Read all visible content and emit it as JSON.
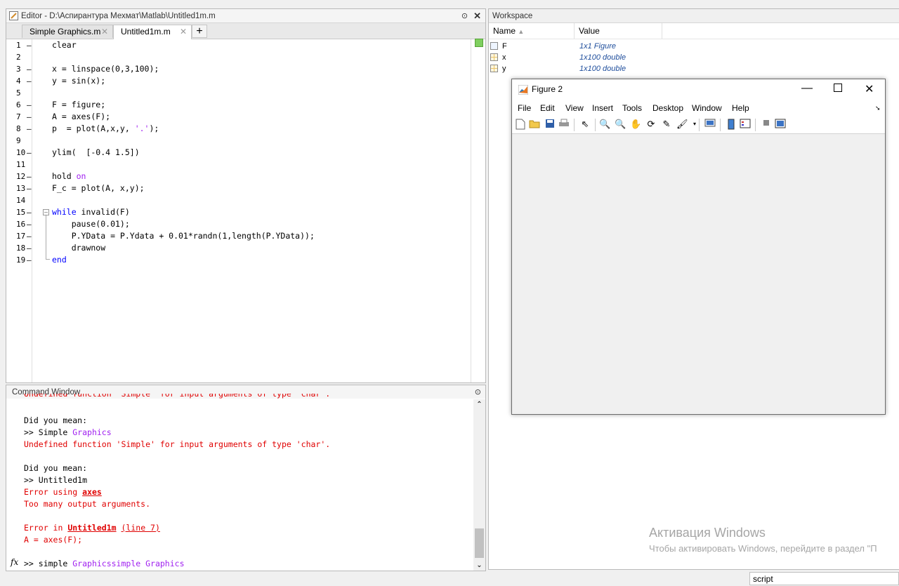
{
  "editor": {
    "title": "Editor - D:\\Аспирантура Мехмат\\Matlab\\Untitled1m.m",
    "tabs": [
      {
        "label": "Simple Graphics.m"
      },
      {
        "label": "Untitled1m.m"
      }
    ],
    "add_tab": "+",
    "lines": [
      {
        "n": "1",
        "dash": "–",
        "code": "clear"
      },
      {
        "n": "2",
        "dash": "",
        "code": ""
      },
      {
        "n": "3",
        "dash": "–",
        "code": "x = linspace(0,3,100);"
      },
      {
        "n": "4",
        "dash": "–",
        "code": "y = sin(x);"
      },
      {
        "n": "5",
        "dash": "",
        "code": ""
      },
      {
        "n": "6",
        "dash": "–",
        "code": "F = figure;"
      },
      {
        "n": "7",
        "dash": "–",
        "code": "A = axes(F);"
      },
      {
        "n": "8",
        "dash": "–",
        "code_pre": "p  = plot(A,x,y, ",
        "code_str": "'.'",
        "code_post": ");"
      },
      {
        "n": "9",
        "dash": "",
        "code": ""
      },
      {
        "n": "10",
        "dash": "–",
        "code": "ylim(  [-0.4 1.5])"
      },
      {
        "n": "11",
        "dash": "",
        "code": ""
      },
      {
        "n": "12",
        "dash": "–",
        "code_pre": "hold ",
        "code_str": "on"
      },
      {
        "n": "13",
        "dash": "–",
        "code": "F_c = plot(A, x,y);"
      },
      {
        "n": "14",
        "dash": "",
        "code": ""
      },
      {
        "n": "15",
        "dash": "–",
        "code_kw": "while",
        "code_post": " invalid(F)"
      },
      {
        "n": "16",
        "dash": "–",
        "code": "    pause(0.01);"
      },
      {
        "n": "17",
        "dash": "–",
        "code": "    P.YData = P.Ydata + 0.01*randn(1,length(P.YData));"
      },
      {
        "n": "18",
        "dash": "–",
        "code": "    drawnow"
      },
      {
        "n": "19",
        "dash": "–",
        "code_kw": "end"
      }
    ]
  },
  "command_window": {
    "title": "Command Window",
    "cut_line": "Undefined function 'Simple' for input arguments of type 'char'.",
    "block1": {
      "did_you_mean": "Did you mean:",
      "prompt": ">> Simple ",
      "prompt_str": "Graphics",
      "error": "Undefined function 'Simple' for input arguments of type 'char'."
    },
    "block2": {
      "did_you_mean": "Did you mean:",
      "prompt": ">> Untitled1m",
      "error_using": "Error using ",
      "error_using_link": "axes",
      "too_many": "Too many output arguments."
    },
    "block3": {
      "error_in": "Error in ",
      "error_in_link": "Untitled1m",
      "line_link": "(line 7)",
      "code": "A = axes(F);"
    },
    "fx": "fx",
    "input_prompt": ">> simple ",
    "input_str": "Graphicssimple Graphics"
  },
  "workspace": {
    "title": "Workspace",
    "headers": {
      "name": "Name",
      "sort": "▲",
      "value": "Value"
    },
    "rows": [
      {
        "name": "F",
        "value": "1x1 Figure"
      },
      {
        "name": "x",
        "value": "1x100 double"
      },
      {
        "name": "y",
        "value": "1x100 double"
      }
    ]
  },
  "figure": {
    "title": "Figure 2",
    "menu": [
      "File",
      "Edit",
      "View",
      "Insert",
      "Tools",
      "Desktop",
      "Window",
      "Help"
    ]
  },
  "watermark": {
    "title": "Активация Windows",
    "subtitle": "Чтобы активировать Windows, перейдите в раздел \"П"
  },
  "status": {
    "label": "script"
  },
  "colors": {
    "keyword": "#0000ff",
    "string": "#a020f0",
    "error": "#e00000",
    "ws_value": "#1f4e9c"
  }
}
